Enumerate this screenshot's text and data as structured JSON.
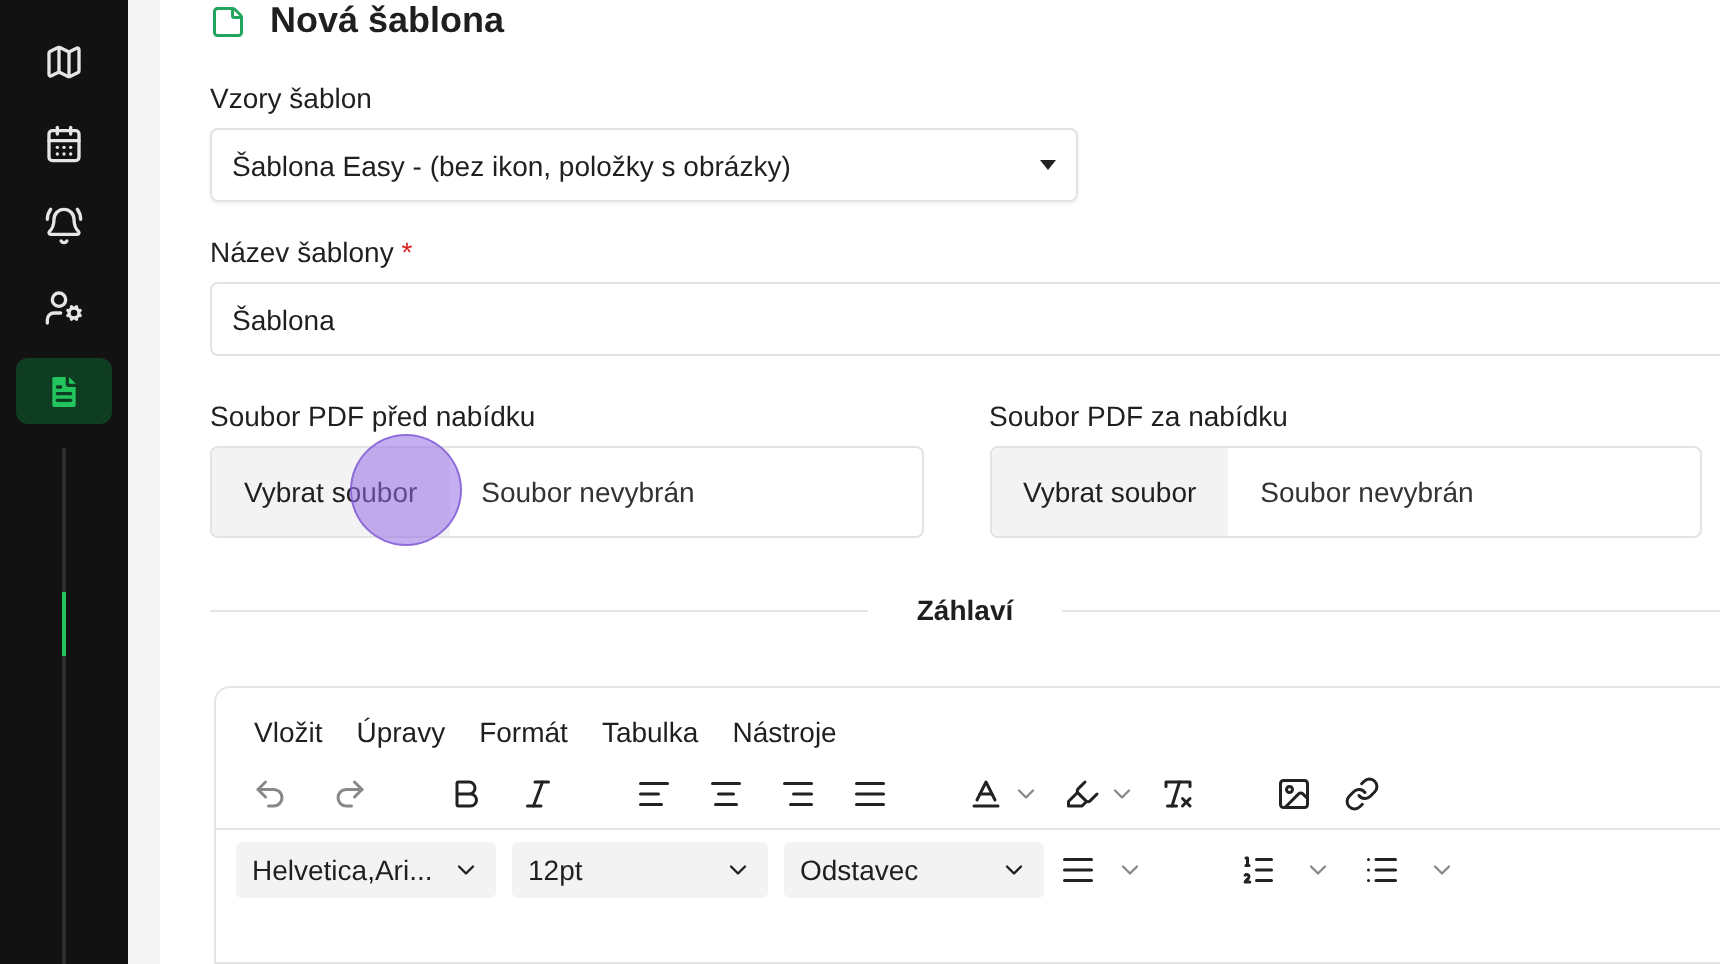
{
  "sidebar": {
    "items": [
      {
        "selected": false
      },
      {
        "selected": false
      },
      {
        "selected": false
      },
      {
        "selected": false
      },
      {
        "selected": true
      }
    ]
  },
  "page": {
    "title": "Nová šablona"
  },
  "template_select": {
    "label": "Vzory šablon",
    "value": "Šablona Easy - (bez ikon, položky s obrázky)"
  },
  "name_field": {
    "label": "Název šablony",
    "required_mark": "*",
    "value": "Šablona"
  },
  "file_inputs": [
    {
      "label": "Soubor PDF před nabídku",
      "button": "Vybrat soubor",
      "status": "Soubor nevybrán",
      "click_highlight": true
    },
    {
      "label": "Soubor PDF za nabídku",
      "button": "Vybrat soubor",
      "status": "Soubor nevybrán",
      "click_highlight": false
    }
  ],
  "section_heading": "Záhlaví",
  "editor": {
    "menu": [
      "Vložit",
      "Úpravy",
      "Formát",
      "Tabulka",
      "Nástroje"
    ],
    "font_family": "Helvetica,Ari...",
    "font_size": "12pt",
    "block_format": "Odstavec"
  }
}
